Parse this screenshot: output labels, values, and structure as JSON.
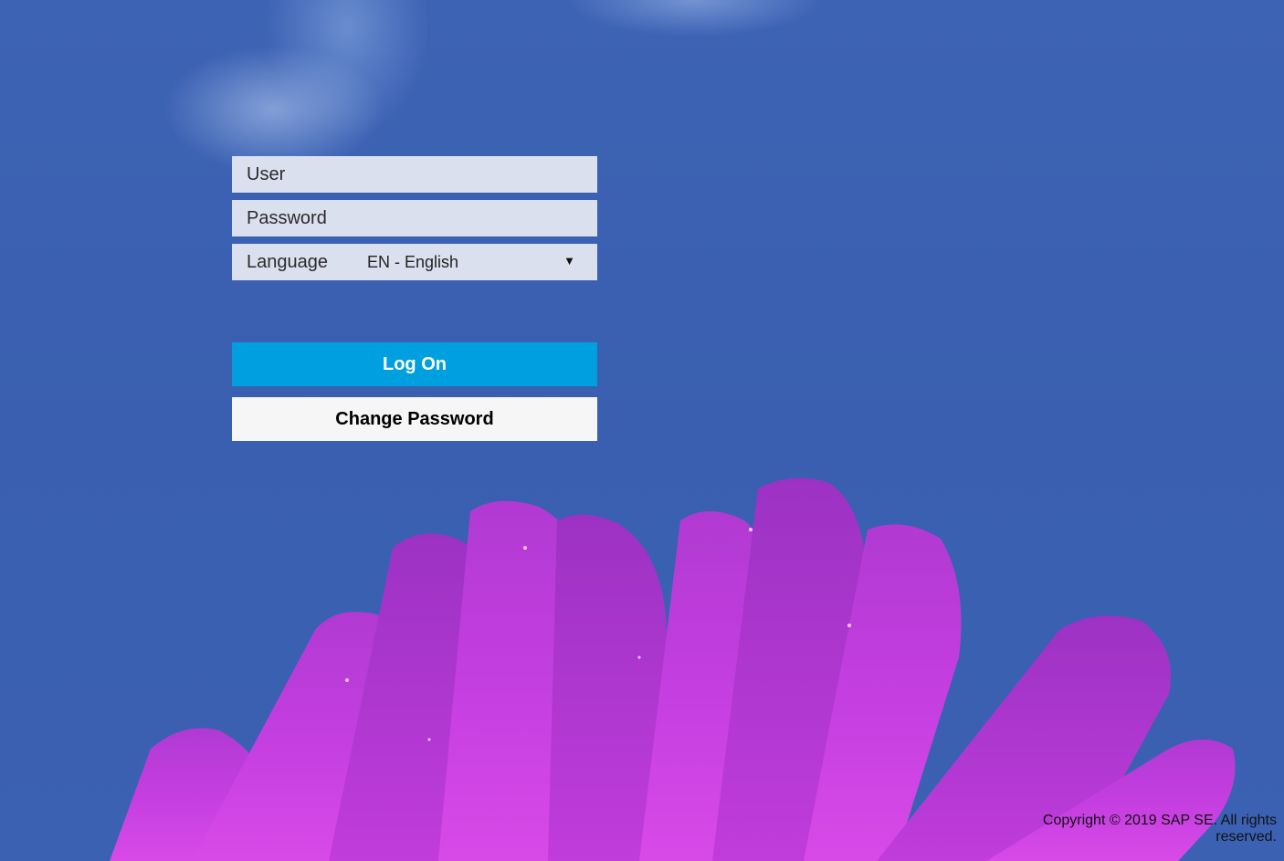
{
  "login": {
    "user_placeholder": "User",
    "password_placeholder": "Password",
    "language_label": "Language",
    "language_value": "EN - English",
    "language_arrow": "▼",
    "logon_label": "Log On",
    "change_password_label": "Change Password"
  },
  "footer": {
    "copyright": "Copyright © 2019 SAP SE. All rights reserved."
  },
  "colors": {
    "background_blue": "#3a5fb2",
    "field_bg": "#dbe0ef",
    "logon_button": "#00a0e0",
    "change_button": "#f6f6f6",
    "flower_petal": "#c23bd8"
  },
  "icons": {
    "language_dropdown": "chevron-down-icon"
  }
}
